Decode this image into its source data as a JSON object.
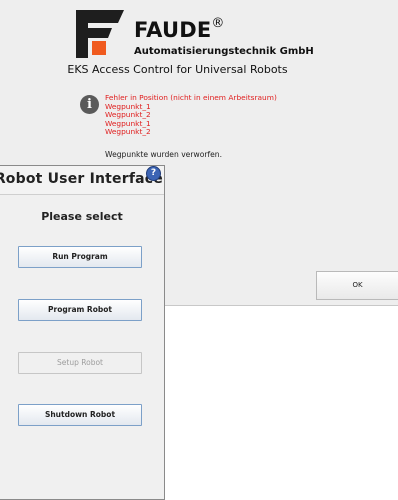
{
  "eks_dialog": {
    "brand_name": "FAUDE",
    "brand_mark": "®",
    "brand_sub": "Automatisierungstechnik GmbH",
    "title": "EKS Access Control for Universal Robots",
    "error_heading": "Fehler in Position (nicht in einem Arbeitsraum)",
    "waypoints": [
      "Wegpunkt_1",
      "Wegpunkt_2",
      "Wegpunkt_1",
      "Wegpunkt_2"
    ],
    "discard_message": "Wegpunkte wurden verworfen.",
    "ok_label": "OK",
    "info_icon_glyph": "i",
    "colors": {
      "error": "#e02020",
      "logo_orange": "#f05a1e",
      "logo_dark": "#1e1e1e"
    }
  },
  "ur_panel": {
    "title": "Robot User Interface",
    "help_glyph": "?",
    "prompt": "Please select",
    "buttons": {
      "run": "Run Program",
      "program": "Program Robot",
      "setup": "Setup Robot",
      "shutdown": "Shutdown Robot"
    },
    "setup_enabled": false
  }
}
